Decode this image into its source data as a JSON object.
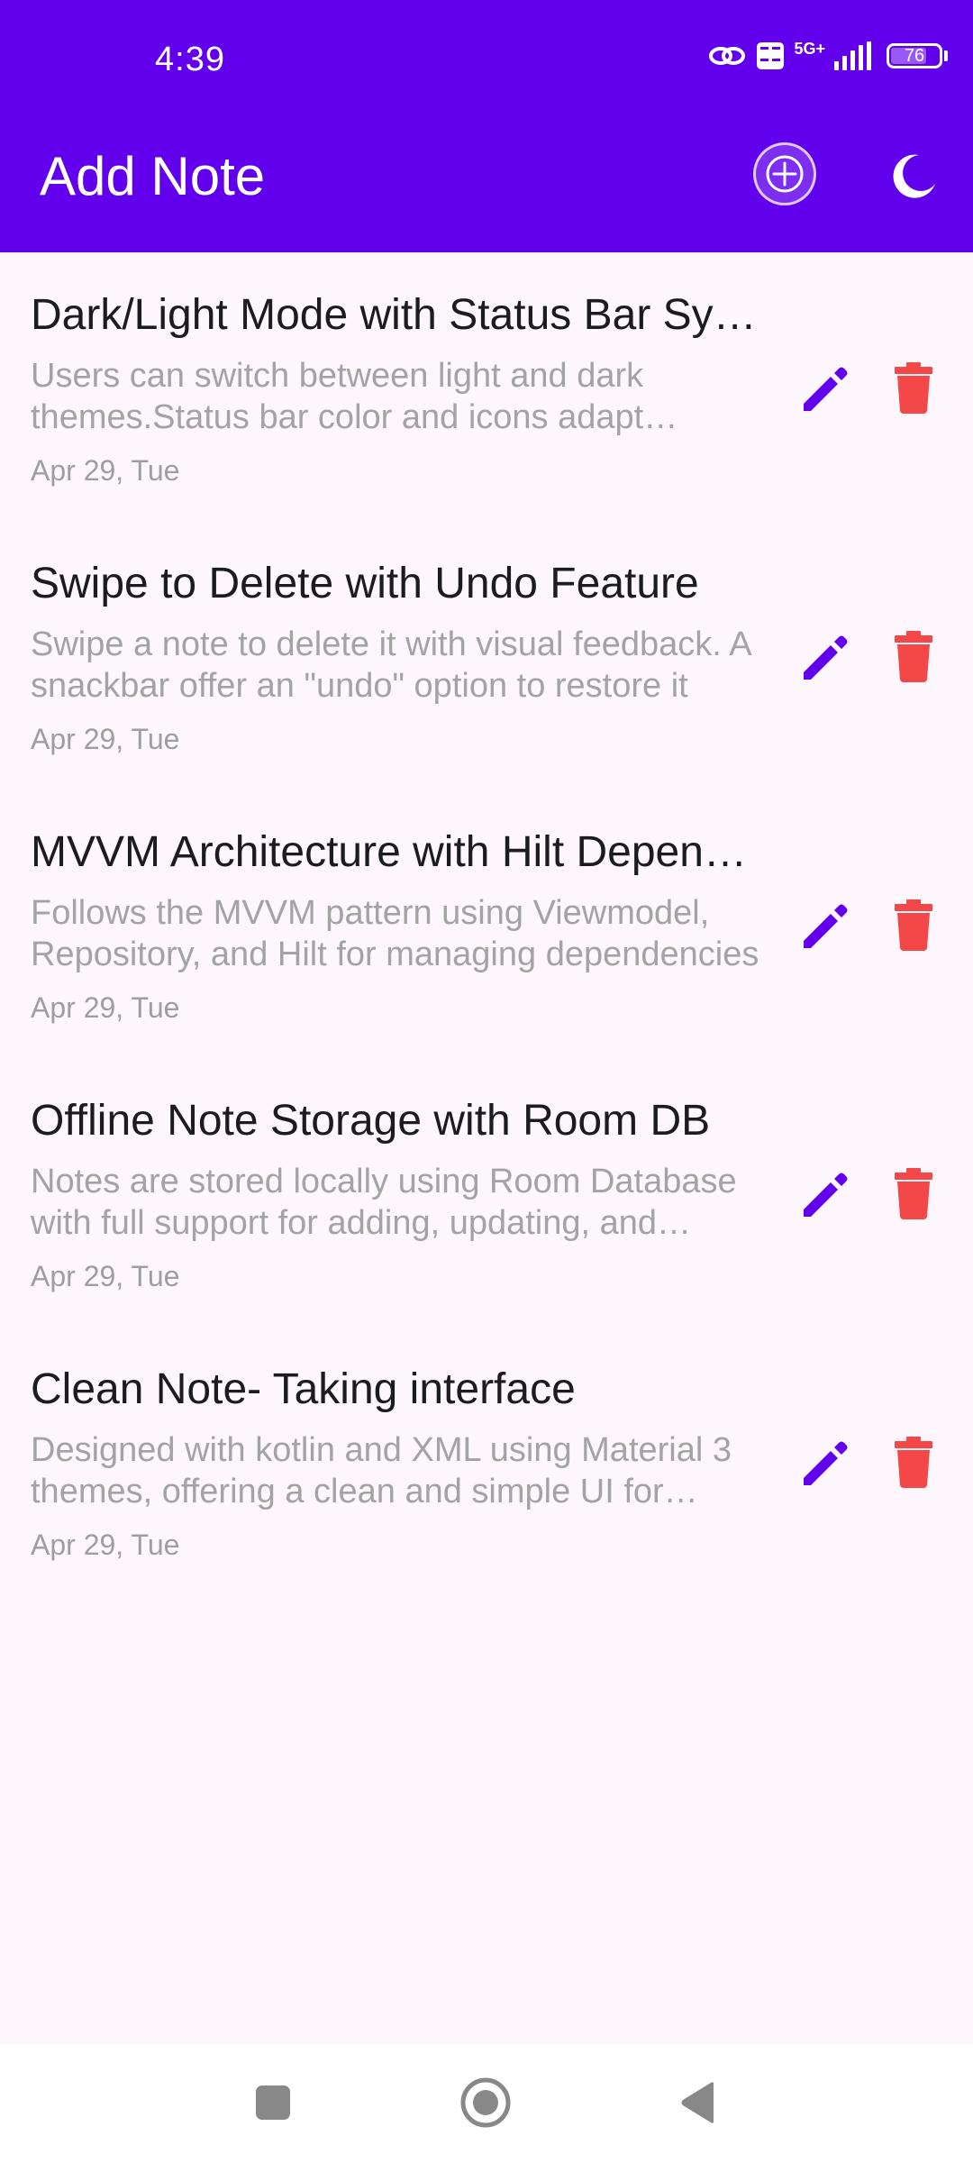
{
  "status_bar": {
    "time": "4:39",
    "network_label": "5G+",
    "battery_level": "76",
    "battery_percent": 76
  },
  "app_bar": {
    "title": "Add Note",
    "add_icon": "add-circle-icon",
    "theme_icon": "moon-icon"
  },
  "notes": [
    {
      "title": "Dark/Light Mode with Status Bar Sync",
      "description": "Users can switch between light and dark themes.Status bar color and icons adapt accordingly",
      "date": "Apr 29, Tue"
    },
    {
      "title": "Swipe to Delete with Undo Feature",
      "description": "Swipe a note to delete it with visual feedback. A snackbar offer an \"undo\" option to restore it",
      "date": "Apr 29, Tue"
    },
    {
      "title": "MVVM Architecture with Hilt Dependency Injection",
      "description": "Follows the MVVM pattern using Viewmodel, Repository, and Hilt for managing dependencies",
      "date": "Apr 29, Tue"
    },
    {
      "title": "Offline Note Storage with Room DB",
      "description": "Notes are stored locally using Room Database with full support for adding, updating, and deleting",
      "date": "Apr 29, Tue"
    },
    {
      "title": "Clean Note- Taking interface",
      "description": "Designed with kotlin and XML using Material 3 themes, offering a clean and simple UI for capturing notes",
      "date": "Apr 29, Tue"
    }
  ],
  "colors": {
    "primary": "#6200EE",
    "background": "#FDF7FD",
    "edit_icon": "#6200EE",
    "delete_icon": "#F44848",
    "description_text": "#A3A3A3"
  },
  "icons": {
    "edit": "pencil-icon",
    "delete": "trash-icon",
    "nav_recents": "square-icon",
    "nav_home": "circle-icon",
    "nav_back": "triangle-back-icon"
  }
}
